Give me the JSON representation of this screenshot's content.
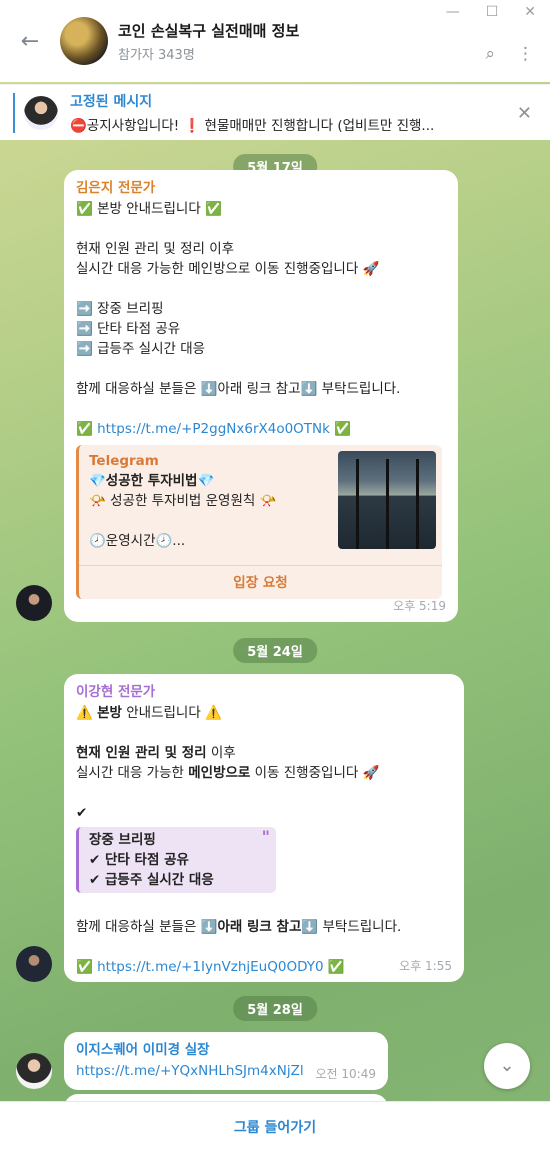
{
  "header": {
    "title": "코인 손실복구 실전매매 정보",
    "subtitle": "참가자 343명"
  },
  "pinned": {
    "title": "고정된 메시지",
    "body": "⛔공지사항입니다!   ❗ 현물매매만 진행합니다 (업비트만 진행..."
  },
  "dates": [
    "5월 17일",
    "5월 24일",
    "5월 28일"
  ],
  "msg1": {
    "sender": "김은지 전문가",
    "lines": [
      "✅ 본방 안내드립니다 ✅",
      "",
      "현재 인원 관리 및 정리 이후",
      "실시간 대응 가능한 메인방으로 이동 진행중입니다 🚀",
      "",
      "➡️ 장중 브리핑",
      "➡️ 단타 타점 공유",
      "➡️ 급등주 실시간 대응",
      "",
      "함께 대응하실 분들은 ⬇️아래 링크 참고⬇️ 부탁드립니다.",
      ""
    ],
    "link_prefix": "✅ ",
    "link": "https://t.me/+P2ggNx6rX4o0OTNk",
    "link_suffix": " ✅",
    "preview": {
      "site": "Telegram",
      "title": "💎성공한 투자비법💎",
      "line1": "📯 성공한 투자비법 운영원칙 📯",
      "line2": "",
      "line3": "🕗운영시간🕗...",
      "button": "입장 요청"
    },
    "time": "오후 5:19"
  },
  "msg2": {
    "sender": "이강현 전문가",
    "line1_a": "⚠️ ",
    "line1_b": "본방",
    "line1_c": " 안내드립니다 ⚠️",
    "line2_a": "현재 인원 관리 및 정리",
    "line2_b": " 이후",
    "line3_a": "실시간 대응 가능한 ",
    "line3_b": "메인방으로",
    "line3_c": " 이동 진행중입니다 🚀",
    "check": "✔",
    "quote": [
      "장중 브리핑",
      "✔ 단타 타점 공유",
      "✔ 급등주 실시간 대응"
    ],
    "quote_mark": "\"",
    "line4_a": "함께 대응하실 분들은 ",
    "line4_b": "⬇️아래 링크 참고⬇️",
    "line4_c": " 부탁드립니다.",
    "link_prefix": "✅ ",
    "link": "https://t.me/+1IynVzhjEuQ0ODY0",
    "link_suffix": " ✅",
    "time": "오후 1:55"
  },
  "msg3": {
    "sender": "이지스퀘어 이미경 실장",
    "link": "https://t.me/+YQxNHLhSJm4xNjZl",
    "time": "오전 10:49"
  },
  "footer": {
    "join_label": "그룹 들어가기"
  },
  "colors": {
    "accent": "#2c87d1",
    "sender1": "#d9822b",
    "sender2": "#a66ed4",
    "sender3": "#2c87d1"
  }
}
